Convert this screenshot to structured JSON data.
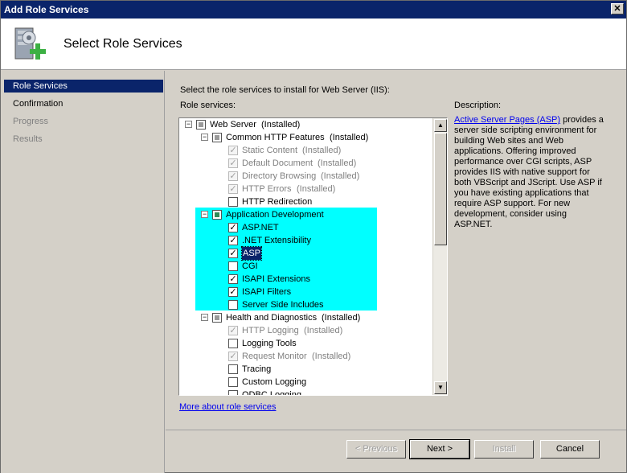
{
  "window": {
    "title": "Add Role Services"
  },
  "header": {
    "page_title": "Select Role Services"
  },
  "nav": {
    "items": [
      {
        "label": "Role Services",
        "state": "selected"
      },
      {
        "label": "Confirmation",
        "state": "normal"
      },
      {
        "label": "Progress",
        "state": "disabled"
      },
      {
        "label": "Results",
        "state": "disabled"
      }
    ]
  },
  "content": {
    "prompt": "Select the role services to install for Web Server (IIS):",
    "role_services_label": "Role services:",
    "description_label": "Description:",
    "description_link": "Active Server Pages (ASP)",
    "description_text": " provides a server side scripting environment for building Web sites and Web applications. Offering improved performance over CGI scripts, ASP provides IIS with native support for both VBScript and JScript. Use ASP if you have existing applications that require ASP support. For new development, consider using ASP.NET.",
    "more_link": "More about role services"
  },
  "tree": {
    "nodes": [
      {
        "label": "Web Server",
        "status": "(Installed)",
        "level": 0,
        "expander": "−",
        "check": "partial",
        "grey": false
      },
      {
        "label": "Common HTTP Features",
        "status": "(Installed)",
        "level": 1,
        "expander": "−",
        "check": "partial",
        "grey": false
      },
      {
        "label": "Static Content",
        "status": "(Installed)",
        "level": 2,
        "expander": "",
        "check": "checked-disabled",
        "grey": true
      },
      {
        "label": "Default Document",
        "status": "(Installed)",
        "level": 2,
        "expander": "",
        "check": "checked-disabled",
        "grey": true
      },
      {
        "label": "Directory Browsing",
        "status": "(Installed)",
        "level": 2,
        "expander": "",
        "check": "checked-disabled",
        "grey": true
      },
      {
        "label": "HTTP Errors",
        "status": "(Installed)",
        "level": 2,
        "expander": "",
        "check": "checked-disabled",
        "grey": true
      },
      {
        "label": "HTTP Redirection",
        "status": "",
        "level": 2,
        "expander": "",
        "check": "unchecked",
        "grey": false
      },
      {
        "label": "Application Development",
        "status": "",
        "level": 1,
        "expander": "−",
        "check": "partial-app",
        "grey": false
      },
      {
        "label": "ASP.NET",
        "status": "",
        "level": 2,
        "expander": "",
        "check": "checked",
        "grey": false
      },
      {
        "label": ".NET Extensibility",
        "status": "",
        "level": 2,
        "expander": "",
        "check": "checked",
        "grey": false
      },
      {
        "label": "ASP",
        "status": "",
        "level": 2,
        "expander": "",
        "check": "checked",
        "grey": false,
        "selected": true
      },
      {
        "label": "CGI",
        "status": "",
        "level": 2,
        "expander": "",
        "check": "unchecked",
        "grey": false
      },
      {
        "label": "ISAPI Extensions",
        "status": "",
        "level": 2,
        "expander": "",
        "check": "checked",
        "grey": false
      },
      {
        "label": "ISAPI Filters",
        "status": "",
        "level": 2,
        "expander": "",
        "check": "checked",
        "grey": false
      },
      {
        "label": "Server Side Includes",
        "status": "",
        "level": 2,
        "expander": "",
        "check": "unchecked",
        "grey": false
      },
      {
        "label": "Health and Diagnostics",
        "status": "(Installed)",
        "level": 1,
        "expander": "−",
        "check": "partial",
        "grey": false
      },
      {
        "label": "HTTP Logging",
        "status": "(Installed)",
        "level": 2,
        "expander": "",
        "check": "checked-disabled",
        "grey": true
      },
      {
        "label": "Logging Tools",
        "status": "",
        "level": 2,
        "expander": "",
        "check": "unchecked",
        "grey": false
      },
      {
        "label": "Request Monitor",
        "status": "(Installed)",
        "level": 2,
        "expander": "",
        "check": "checked-disabled",
        "grey": true
      },
      {
        "label": "Tracing",
        "status": "",
        "level": 2,
        "expander": "",
        "check": "unchecked",
        "grey": false
      },
      {
        "label": "Custom Logging",
        "status": "",
        "level": 2,
        "expander": "",
        "check": "unchecked",
        "grey": false
      },
      {
        "label": "ODBC Logging",
        "status": "",
        "level": 2,
        "expander": "",
        "check": "unchecked",
        "grey": false
      }
    ]
  },
  "buttons": {
    "previous": "< Previous",
    "next": "Next >",
    "install": "Install",
    "cancel": "Cancel"
  },
  "colors": {
    "title_bar": "#0a246a",
    "highlight": "#00ffff",
    "link": "#0000ee"
  }
}
